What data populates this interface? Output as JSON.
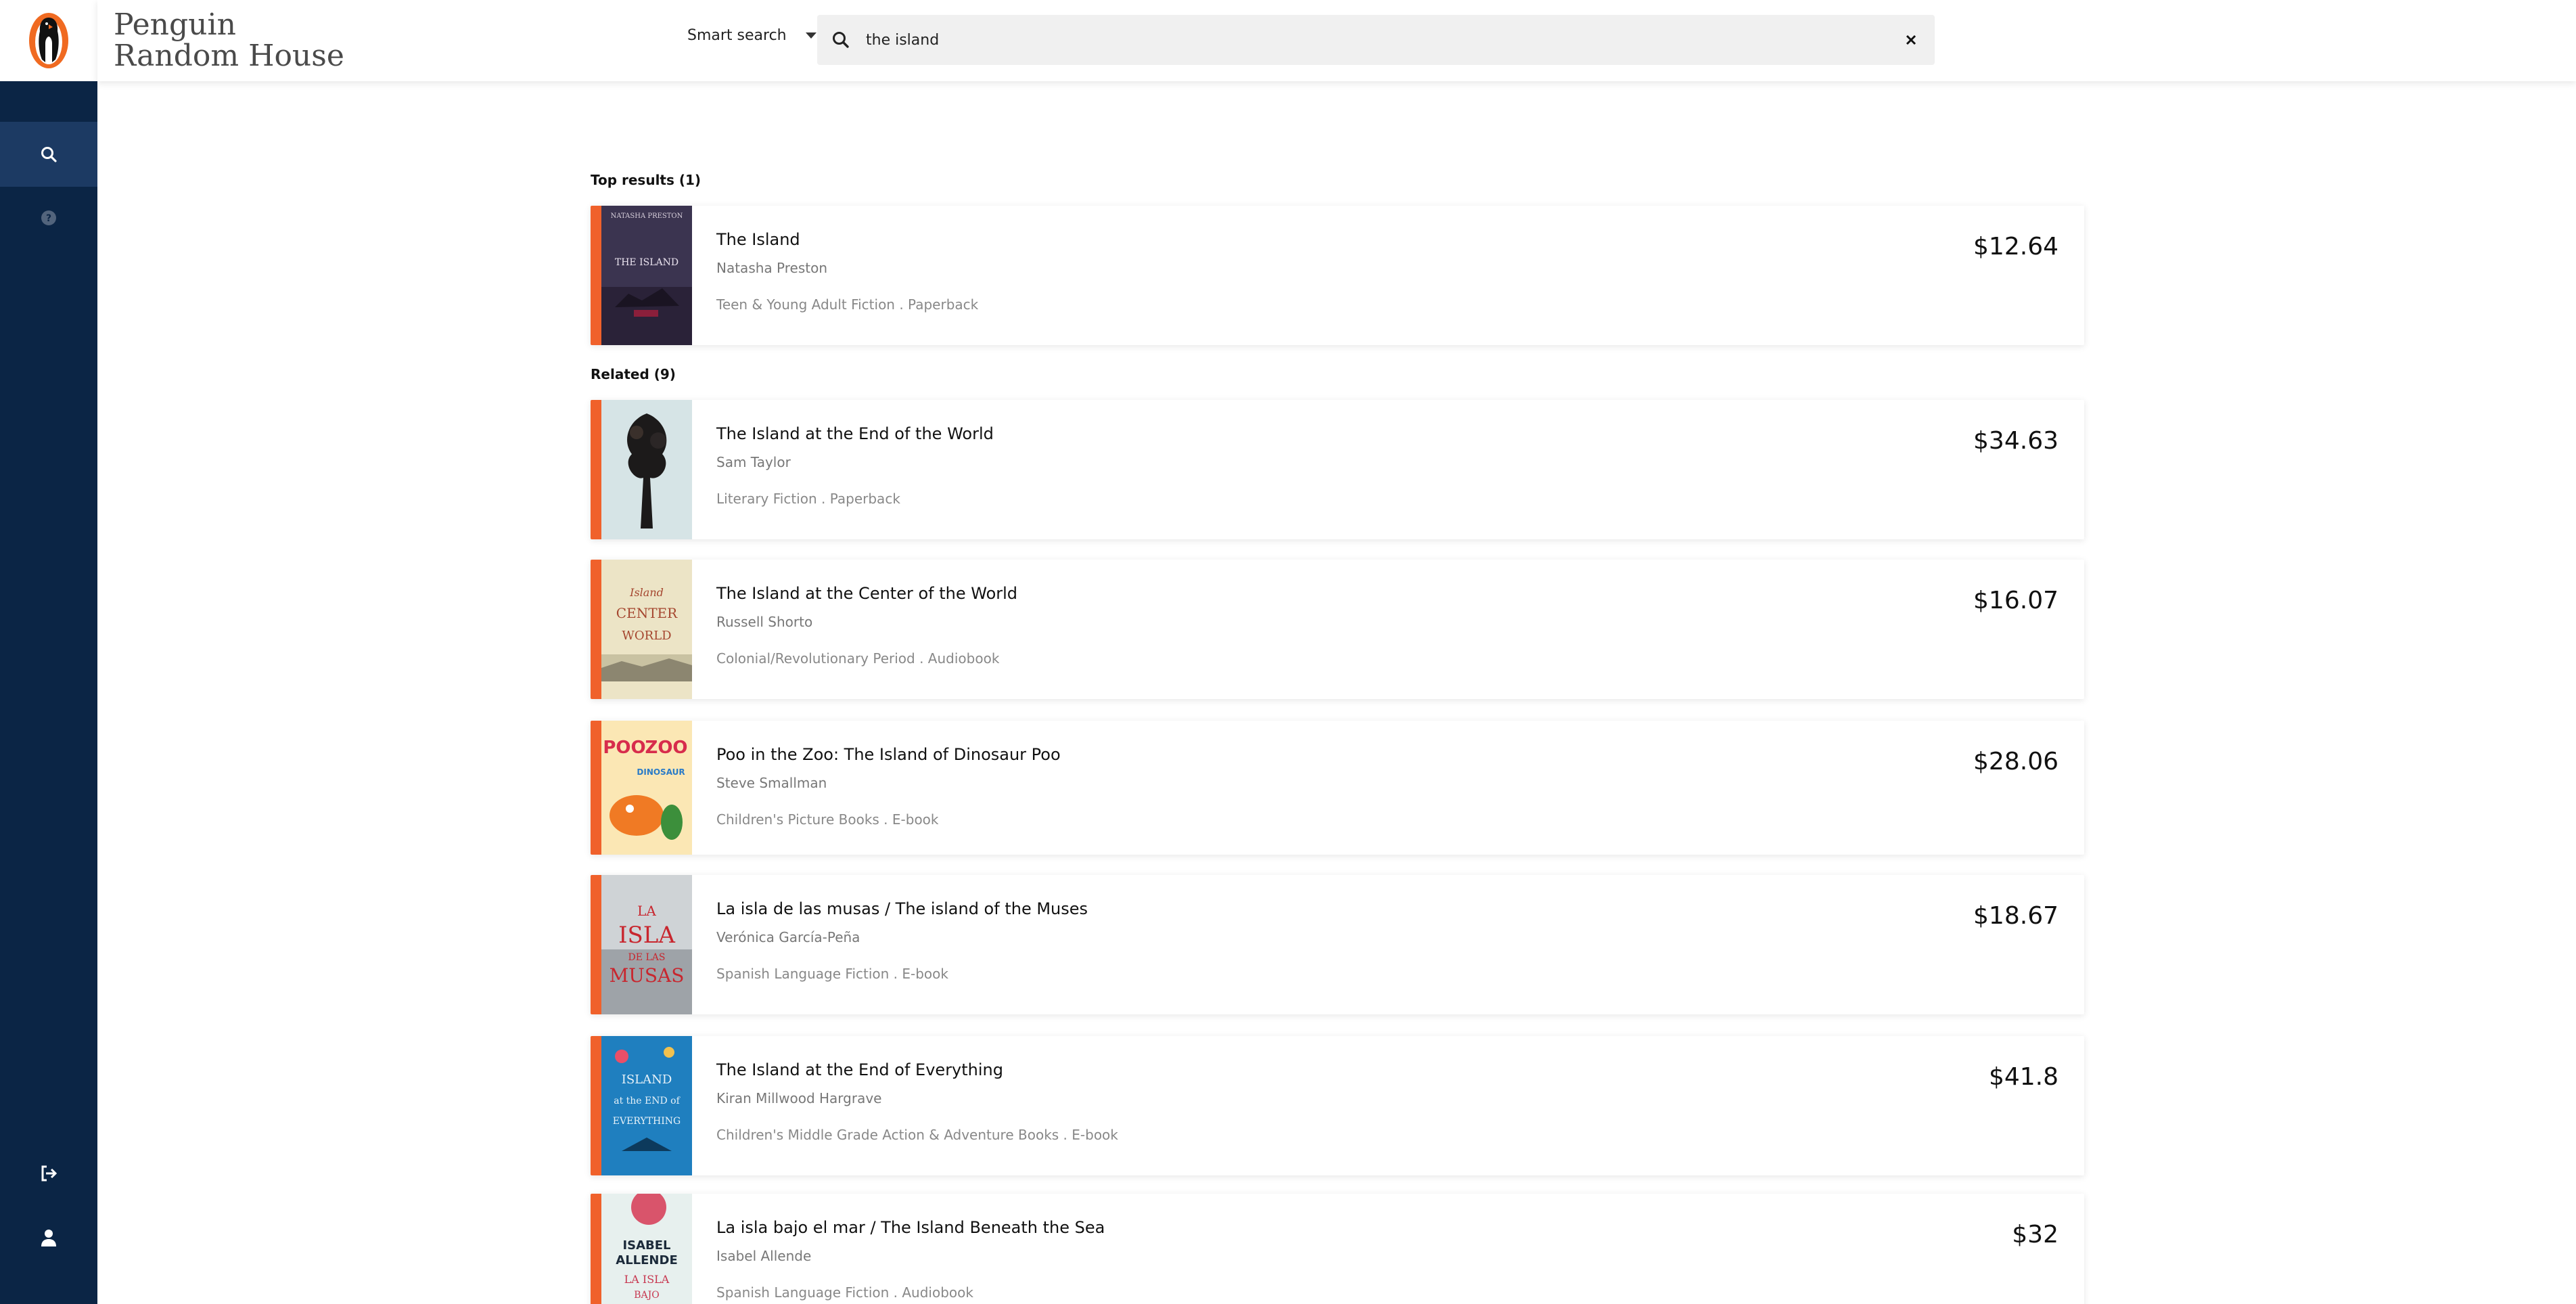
{
  "brand": {
    "line1": "Penguin",
    "line2": "Random House"
  },
  "header": {
    "search_mode": "Smart search",
    "search_value": "the island"
  },
  "sidebar": {
    "icons": [
      "search-icon",
      "help-icon",
      "logout-icon",
      "user-icon"
    ]
  },
  "sections": {
    "top_label": "Top results (1)",
    "related_label": "Related (9)"
  },
  "top_results": [
    {
      "title": "The Island",
      "author": "Natasha Preston",
      "meta": "Teen & Young Adult Fiction . Paperback",
      "price": "$12.64",
      "cover_color": "#3b3450"
    }
  ],
  "related": [
    {
      "title": "The Island at the End of the World",
      "author": "Sam Taylor",
      "meta": "Literary Fiction . Paperback",
      "price": "$34.63",
      "cover_color": "#d6e4e6"
    },
    {
      "title": "The Island at the Center of the World",
      "author": "Russell Shorto",
      "meta": "Colonial/Revolutionary Period . Audiobook",
      "price": "$16.07",
      "cover_color": "#ece4c6"
    },
    {
      "title": "Poo in the Zoo: The Island of Dinosaur Poo",
      "author": "Steve Smallman",
      "meta": "Children's Picture Books . E-book",
      "price": "$28.06",
      "cover_color": "#fbe7b4"
    },
    {
      "title": "La isla de las musas / The island of the Muses",
      "author": "Verónica García-Peña",
      "meta": "Spanish Language Fiction . E-book",
      "price": "$18.67",
      "cover_color": "#cfd3d6"
    },
    {
      "title": "The Island at the End of Everything",
      "author": "Kiran Millwood Hargrave",
      "meta": "Children's Middle Grade Action & Adventure Books . E-book",
      "price": "$41.8",
      "cover_color": "#1f7fbf"
    },
    {
      "title": "La isla bajo el mar / The Island Beneath the Sea",
      "author": "Isabel Allende",
      "meta": "Spanish Language Fiction . Audiobook",
      "price": "$32",
      "cover_color": "#e7f0ee"
    }
  ]
}
